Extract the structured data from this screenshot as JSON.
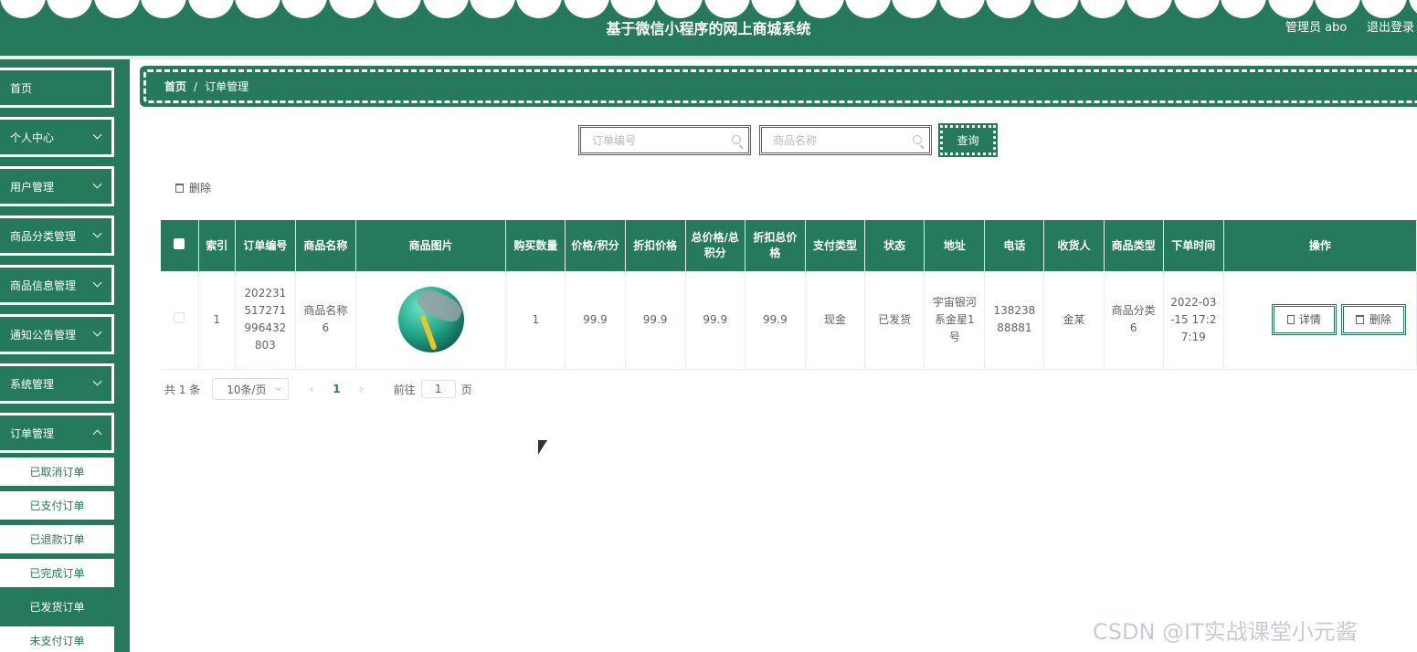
{
  "header": {
    "title": "基于微信小程序的网上商城系统",
    "admin": "管理员 abo",
    "logout": "退出登录"
  },
  "sidebar": {
    "items": [
      {
        "label": "首页"
      },
      {
        "label": "个人中心"
      },
      {
        "label": "用户管理"
      },
      {
        "label": "商品分类管理"
      },
      {
        "label": "商品信息管理"
      },
      {
        "label": "通知公告管理"
      },
      {
        "label": "系统管理"
      },
      {
        "label": "订单管理"
      }
    ],
    "sub_items": [
      {
        "label": "已取消订单"
      },
      {
        "label": "已支付订单"
      },
      {
        "label": "已退款订单"
      },
      {
        "label": "已完成订单"
      },
      {
        "label": "已发货订单"
      },
      {
        "label": "未支付订单"
      }
    ]
  },
  "breadcrumb": {
    "home": "首页",
    "separator": "/",
    "current": "订单管理"
  },
  "search": {
    "order_no_placeholder": "订单编号",
    "product_name_placeholder": "商品名称",
    "query_label": "查询"
  },
  "actions": {
    "delete_label": "删除"
  },
  "table": {
    "headers": [
      "索引",
      "订单编号",
      "商品名称",
      "商品图片",
      "购买数量",
      "价格/积分",
      "折扣价格",
      "总价格/总积分",
      "折扣总价格",
      "支付类型",
      "状态",
      "地址",
      "电话",
      "收货人",
      "商品类型",
      "下单时间",
      "操作"
    ],
    "rows": [
      {
        "index": "1",
        "order_no": "202231517271996432803",
        "product_name": "商品名称6",
        "quantity": "1",
        "price": "99.9",
        "discount_price": "99.9",
        "total_price": "99.9",
        "discount_total": "99.9",
        "pay_type": "现金",
        "status": "已发货",
        "address": "宇宙银河系金星1号",
        "phone": "13823888881",
        "receiver": "金某",
        "product_type": "商品分类6",
        "order_time": "2022-03-15 17:27:19",
        "detail_label": "详情",
        "delete_label": "删除"
      }
    ]
  },
  "pagination": {
    "total": "共 1 条",
    "page_size": "10条/页",
    "current_page": "1",
    "goto_label": "前往",
    "goto_value": "1",
    "page_suffix": "页"
  },
  "watermark": "CSDN @IT实战课堂小元酱",
  "colors": {
    "primary": "#267a5c",
    "white": "#ffffff"
  }
}
